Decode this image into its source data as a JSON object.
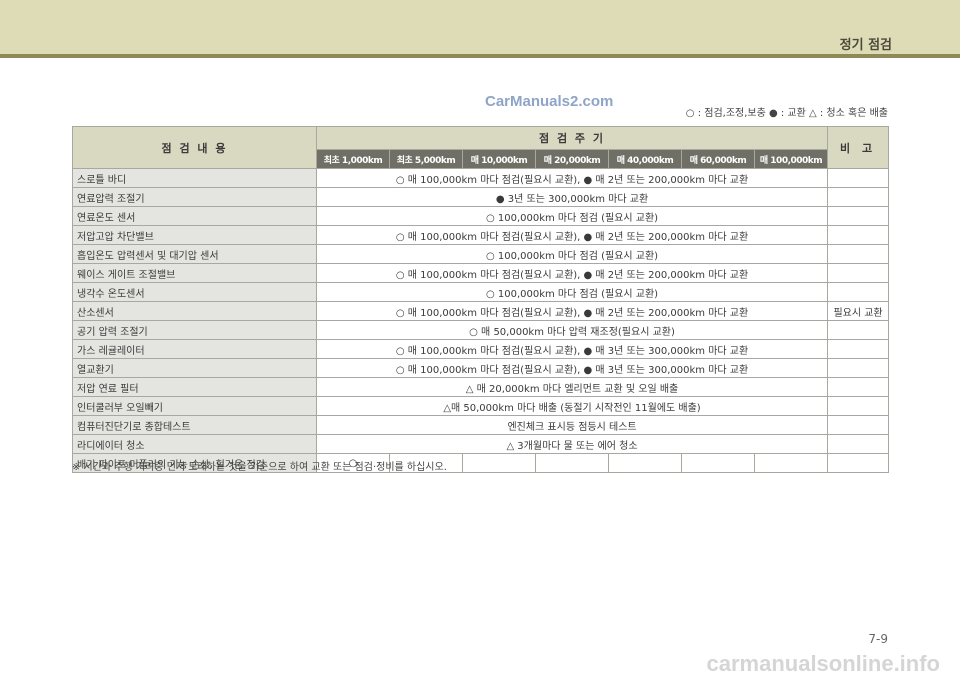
{
  "header": {
    "section_title": "정기 점검"
  },
  "watermark_top": "CarManuals2.com",
  "legend": "○ : 점검,조정,보충  ● : 교환  △ : 청소 혹은 배출",
  "table": {
    "col_item": "점  검  내  용",
    "col_period": "점  검  주  기",
    "col_remarks": "비  고",
    "intervals": [
      "최초 1,000km",
      "최초 5,000km",
      "매 10,000km",
      "매 20,000km",
      "매 40,000km",
      "매 60,000km",
      "매 100,000km"
    ],
    "rows": [
      {
        "item": "스로틀 바디",
        "period": "○ 매 100,000km 마다 점검(필요시 교환), ● 매 2년 또는 200,000km 마다 교환",
        "remark": ""
      },
      {
        "item": "연료압력 조절기",
        "period": "● 3년 또는 300,000km 마다 교환",
        "remark": ""
      },
      {
        "item": "연료온도 센서",
        "period": "○ 100,000km 마다 점검 (필요시 교환)",
        "remark": ""
      },
      {
        "item": "저압고압 차단밸브",
        "period": "○ 매 100,000km 마다 점검(필요시 교환), ● 매 2년 또는 200,000km 마다 교환",
        "remark": ""
      },
      {
        "item": "흡입온도 압력센서 및 대기압 센서",
        "period": "○ 100,000km 마다 점검 (필요시 교환)",
        "remark": ""
      },
      {
        "item": "웨이스 게이트 조절밸브",
        "period": "○ 매 100,000km 마다 점검(필요시 교환), ● 매 2년 또는 200,000km 마다 교환",
        "remark": ""
      },
      {
        "item": "냉각수 온도센서",
        "period": "○ 100,000km 마다 점검 (필요시 교환)",
        "remark": ""
      },
      {
        "item": "산소센서",
        "period": "○ 매 100,000km 마다 점검(필요시 교환), ● 매 2년 또는 200,000km 마다 교환",
        "remark": "필요시 교환"
      },
      {
        "item": "공기 압력 조절기",
        "period": "○ 매 50,000km 마다 압력 재조정(필요시 교환)",
        "remark": ""
      },
      {
        "item": "가스 레귤레이터",
        "period": "○ 매 100,000km 마다 점검(필요시 교환), ● 매 3년 또는 300,000km 마다 교환",
        "remark": ""
      },
      {
        "item": "열교환기",
        "period": "○ 매 100,000km 마다 점검(필요시 교환), ● 매 3년 또는 300,000km 마다 교환",
        "remark": ""
      },
      {
        "item": "저압 연료 필터",
        "period": "△ 매 20,000km 마다 엘리먼트 교환 및 오일 배출",
        "remark": ""
      },
      {
        "item": "인터쿨러부 오일빼기",
        "period": "△매 50,000km 마다 배출 (동절기 시작전인 11월에도 배출)",
        "remark": ""
      },
      {
        "item": "컴퓨터진단기로 종합테스트",
        "period": "엔진체크 표시등 점등시 테스트",
        "remark": ""
      },
      {
        "item": "라디에이터 청소",
        "period": "△ 3개월마다 물 또는 에어 청소",
        "remark": ""
      }
    ],
    "last_row": {
      "item": "배기 파이프 머플러의 기능 손상, 헐거움 점검",
      "first_interval_mark": "○"
    }
  },
  "footnote": "※ 시간과 주행 거리중 먼저 도래하는 것을 기준으로 하여 교환 또는 점검·정비를 하십시오.",
  "page_number": "7-9",
  "watermark_bottom": "carmanualsonline.info"
}
